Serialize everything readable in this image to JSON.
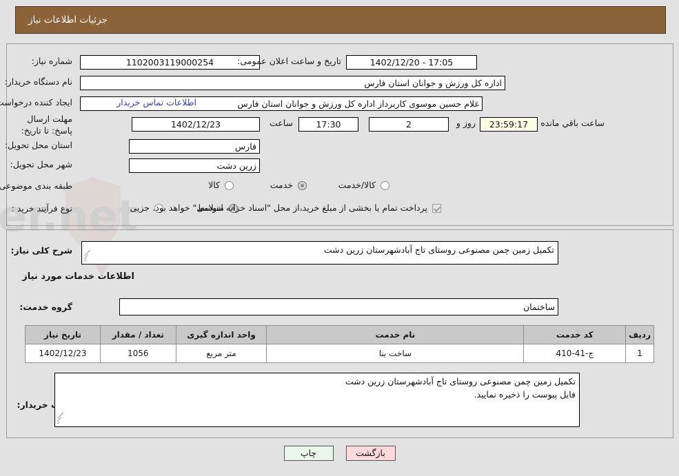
{
  "header": {
    "title": "جزئیات اطلاعات نیاز"
  },
  "watermark": {
    "text": "AriaTender.net"
  },
  "top": {
    "need_number_label": "شماره نیاز:",
    "need_number_value": "1102003119000254",
    "announce_label": "تاریخ و ساعت اعلان عمومی:",
    "announce_value": "17:05 - 1402/12/20",
    "buyer_org_label": "نام دستگاه خریدار:",
    "buyer_org_value": "اداره کل ورزش و جوانان استان فارس",
    "creator_label": "ایجاد کننده درخواست:",
    "creator_value": "غلام حسین موسوی کاربرداز اداره کل ورزش و جوانان استان فارس",
    "contact_link": "اطلاعات تماس خریدار",
    "deadline_label": "مهلت ارسال پاسخ: تا تاریخ:",
    "deadline_date": "1402/12/23",
    "hour_label": "ساعت",
    "deadline_time": "17:30",
    "days_value": "2",
    "days_label": "روز و",
    "countdown_value": "23:59:17",
    "countdown_label": "ساعت باقي مانده",
    "province_label": "استان محل تحویل:",
    "province_value": "فارس",
    "city_label": "شهر محل تحویل:",
    "city_value": "زرین دشت",
    "category_label": "طبقه بندی موضوعی:",
    "category_options": [
      {
        "label": "کالا",
        "selected": false
      },
      {
        "label": "خدمت",
        "selected": true
      },
      {
        "label": "کالا/خدمت",
        "selected": false
      }
    ],
    "process_label": "نوع فرآیند خرید :",
    "process_options": [
      {
        "label": "جزیی",
        "selected": false
      },
      {
        "label": "متوسط",
        "selected": true
      }
    ],
    "treasury_checkbox_checked": true,
    "treasury_text": "پرداخت تمام یا بخشی از مبلغ خرید،از محل \"اسناد خزانه اسلامی\" خواهد بود."
  },
  "bottom": {
    "summary_label": "شرح کلی نیاز:",
    "summary_value": "تکمیل زمین چمن مصنوعی روستای تاج آبادشهرستان زرین دشت",
    "services_section_title": "اطلاعات خدمات مورد نیاز",
    "service_group_label": "گروه خدمت:",
    "service_group_value": "ساختمان",
    "table": {
      "headers": [
        "ردیف",
        "کد خدمت",
        "نام خدمت",
        "واحد اندازه گیری",
        "تعداد / مقدار",
        "تاریخ نیاز"
      ],
      "rows": [
        {
          "row": "1",
          "code": "ج-41-410",
          "name": "ساخت بنا",
          "unit": "متر مربع",
          "qty": "1056",
          "date": "1402/12/23"
        }
      ]
    },
    "notes_label": "توضیحات خریدار:",
    "notes_lines": [
      "تکمیل زمین چمن مصنوعی روستای تاج آبادشهرستان زرین دشت",
      "فایل پیوست را ذخیره نمایید."
    ]
  },
  "buttons": {
    "print": "چاپ",
    "back": "بازگشت"
  },
  "colors": {
    "header_bg": "#8c6239",
    "page_bg": "#e2e2e2",
    "link": "#2a3fd0",
    "print_btn": "#eaf6ea",
    "back_btn": "#fcd9da",
    "countdown_bg": "#ffffe6"
  }
}
